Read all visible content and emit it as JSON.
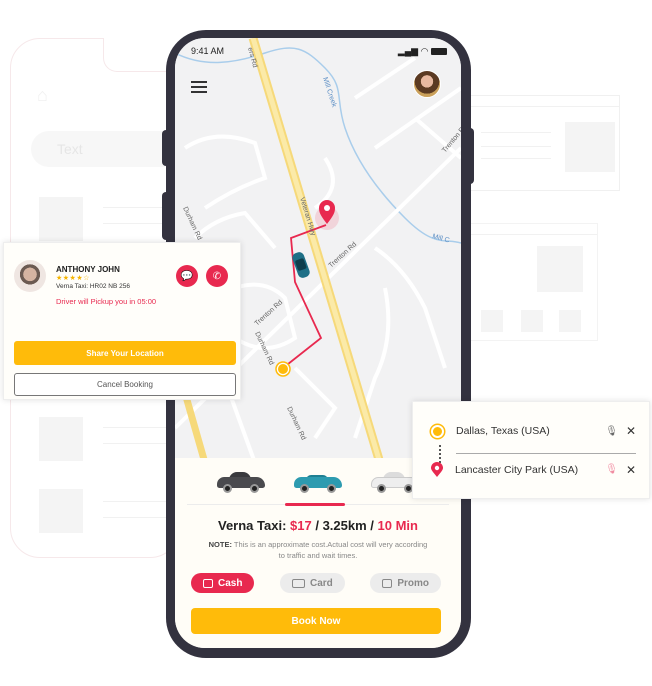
{
  "background": {
    "search_placeholder": "Text",
    "home_icon": "home-icon"
  },
  "phone": {
    "status_bar": {
      "time": "9:41 AM",
      "icons": [
        "signal-icon",
        "wifi-icon",
        "battery-icon"
      ]
    },
    "map": {
      "road_labels": [
        "Veteran Hwy",
        "Trenton Rd",
        "Durham Rd",
        "Durham Rd",
        "Trenton Rd",
        "Mill Creek",
        "Mill C",
        "Trenton Rd",
        "ers Rd"
      ],
      "colors": {
        "route": "#e8294f",
        "highway": "#f7e08a",
        "water": "#9fc8ea"
      }
    },
    "menu_icon": "hamburger-icon",
    "cars": [
      {
        "name": "sports-car",
        "color": "#4a4a4e",
        "selected": false
      },
      {
        "name": "convertible",
        "color": "#2d9bb0",
        "selected": true
      },
      {
        "name": "sedan",
        "color": "#eaeaea",
        "selected": false
      }
    ],
    "fare": {
      "label": "Verna Taxi:",
      "price": "$17",
      "distance": "3.25km",
      "time": "10 Min",
      "separator": " / "
    },
    "note": {
      "label": "NOTE:",
      "text": " This is an approximate cost.Actual cost will very according to traffic and wait times."
    },
    "payment_options": [
      {
        "label": "Cash",
        "icon": "cash-icon",
        "active": true
      },
      {
        "label": "Card",
        "icon": "card-icon",
        "active": false
      },
      {
        "label": "Promo",
        "icon": "gift-icon",
        "active": false
      }
    ],
    "book_button": "Book Now"
  },
  "driver_card": {
    "name": "ANTHONY JOHN",
    "rating": 4.5,
    "stars": "★★★★☆",
    "car": "Verna Taxi: HR02 NB 256",
    "pickup_text": "Driver will Pickup you in 05:00",
    "share_button": "Share Your Location",
    "cancel_button": "Cancel Booking"
  },
  "location_card": {
    "origin": "Dallas, Texas (USA)",
    "destination": "Lancaster City Park (USA)"
  },
  "colors": {
    "accent": "#e8294f",
    "primary": "#ffbb0a",
    "phone_frame": "#33323f"
  }
}
